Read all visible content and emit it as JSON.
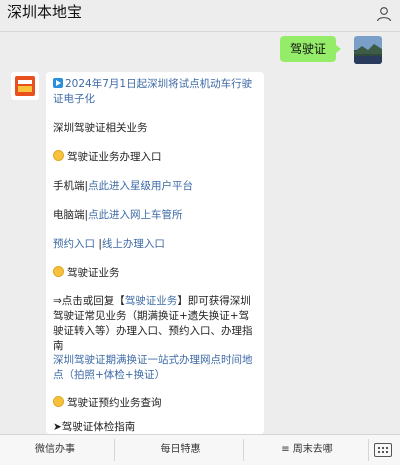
{
  "header": {
    "title": "深圳本地宝"
  },
  "outgoing": {
    "text": "驾驶证"
  },
  "card": {
    "headline": "2024年7月1日起深圳将试点机动车行驶证电子化",
    "related": "深圳驾驶证相关业务",
    "sec1_title": "驾驶证业务办理入口",
    "mobile_prefix": "手机端|",
    "mobile_link": "点此进入星级用户平台",
    "pc_prefix": "电脑端|",
    "pc_link": "点此进入网上车管所",
    "book_link": "预约入口",
    "book_sep": " |",
    "online_link": "线上办理入口",
    "sec2_title": "驾驶证业务",
    "reply_pre": "⇒点击或回复【",
    "reply_kw": "驾驶证业务",
    "reply_post": "】即可获得深圳驾驶证常见业务（期满换证+遗失换证+驾驶证转入等）办理入口、预约入口、办理指南",
    "expire_link": "深圳驾驶证期满换证一站式办理网点时间地点（拍照+体检+换证）",
    "sec3_title": "驾驶证预约业务查询",
    "bottom_link": "➤驾驶证体检指南"
  },
  "tabs": [
    {
      "label": "微信办事"
    },
    {
      "label": "每日特惠"
    },
    {
      "label": "≡ 周末去哪"
    }
  ],
  "colors": {
    "bubble": "#95ec69",
    "link": "#3d6aa6",
    "background": "#ededed"
  }
}
